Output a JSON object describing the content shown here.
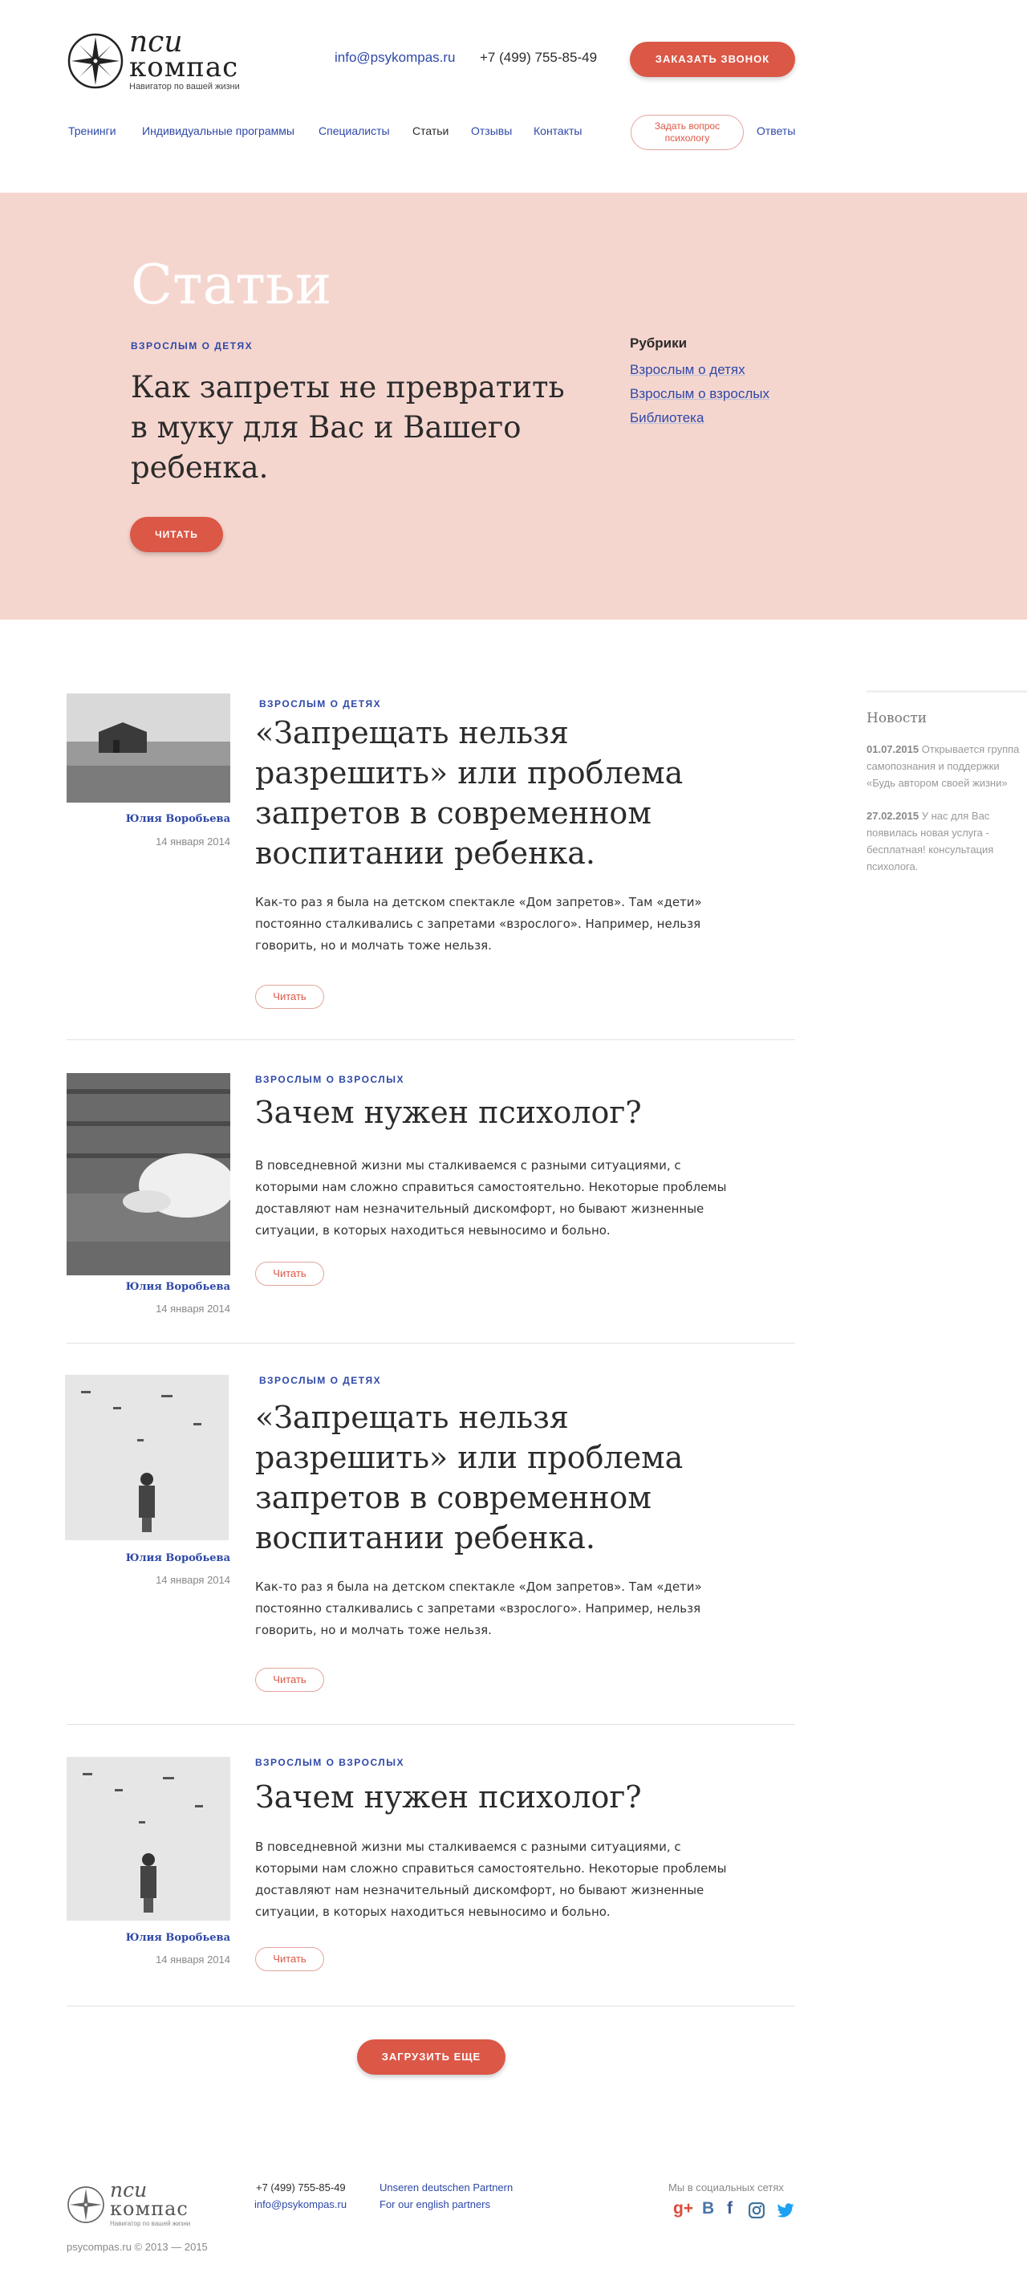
{
  "colors": {
    "accent": "#db5746",
    "link": "#2e48a8",
    "hero_bg": "#f5d6cf"
  },
  "header": {
    "logo_psi": "пси",
    "logo_kompas": "компас",
    "logo_sub": "Навигатор по вашей жизни",
    "email": "info@psykompas.ru",
    "phone": "+7 (499) 755-85-49",
    "call_button": "ЗАКАЗАТЬ ЗВОНОК",
    "nav": [
      "Тренинги",
      "Индивидуальные программы",
      "Специалисты",
      "Статьи",
      "Отзывы",
      "Контакты"
    ],
    "ask_button": "Задать вопрос психологу",
    "answers": "Ответы"
  },
  "hero": {
    "title": "Статьи",
    "category": "ВЗРОСЛЫМ О ДЕТЯХ",
    "headline": "Как запреты не превратить в муку для Вас и Вашего ребенка.",
    "read_button": "ЧИТАТЬ",
    "rubrics_title": "Рубрики",
    "rubrics": [
      "Взрослым о детях",
      "Взрослым о взрослых",
      "Библиотека"
    ]
  },
  "articles": [
    {
      "category": "ВЗРОСЛЫМ О ДЕТЯХ",
      "title": "«Запрещать нельзя разрешить» или проблема запретов в современном воспитании ребенка.",
      "text": "Как-то раз я была на детском спектакле «Дом запретов». Там «дети» постоянно сталкивались с запретами «взрослого». Например, нельзя говорить, но и молчать тоже нельзя.",
      "author": "Юлия Воробьева",
      "date": "14 января 2014",
      "button": "Читать"
    },
    {
      "category": "ВЗРОСЛЫМ О ВЗРОСЛЫХ",
      "title": "Зачем нужен психолог?",
      "text": "В повседневной жизни мы сталкиваемся с разными ситуациями,  с которыми нам сложно справиться самостоятельно.  Некоторые проблемы доставляют нам незначительный дискомфорт, но бывают жизненные ситуации, в которых находиться невыносимо и больно.",
      "author": "Юлия Воробьева",
      "date": "14 января 2014",
      "button": "Читать"
    },
    {
      "category": "ВЗРОСЛЫМ О ДЕТЯХ",
      "title": "«Запрещать нельзя разрешить» или проблема запретов в современном воспитании ребенка.",
      "text": "Как-то раз я была на детском спектакле «Дом запретов». Там «дети» постоянно сталкивались с запретами «взрослого». Например, нельзя говорить, но и молчать тоже нельзя.",
      "author": "Юлия Воробьева",
      "date": "14 января 2014",
      "button": "Читать"
    },
    {
      "category": "ВЗРОСЛЫМ О ВЗРОСЛЫХ",
      "title": "Зачем нужен психолог?",
      "text": "В повседневной жизни мы сталкиваемся с разными ситуациями,  с которыми нам сложно справиться самостоятельно.  Некоторые проблемы доставляют нам незначительный дискомфорт, но бывают жизненные ситуации, в которых находиться невыносимо и больно.",
      "author": "Юлия Воробьева",
      "date": "14 января 2014",
      "button": "Читать"
    }
  ],
  "news": {
    "title": "Новости",
    "items": [
      {
        "date": "01.07.2015",
        "text": "Открывается группа самопознания и поддержки «Будь автором своей жизни»"
      },
      {
        "date": "27.02.2015",
        "text": "У нас для Вас появилась новая услуга - бесплатная! консультация психолога."
      }
    ]
  },
  "load_more": "ЗАГРУЗИТЬ ЕЩЕ",
  "footer": {
    "logo_psi": "пси",
    "logo_kompas": "компас",
    "logo_sub": "Навигатор по вашей жизни",
    "copyright": "psycompas.ru © 2013 — 2015",
    "phone": "+7 (499) 755-85-49",
    "email": "info@psykompas.ru",
    "link_de": "Unseren deutschen Partnern",
    "link_en": "For our english partners",
    "social_title": "Мы в социальных сетях",
    "social_icons": [
      "google-plus-icon",
      "vk-icon",
      "facebook-icon",
      "instagram-icon",
      "twitter-icon"
    ],
    "social_glyphs": {
      "gplus": "g+",
      "vk": "В",
      "fb": "f"
    }
  }
}
